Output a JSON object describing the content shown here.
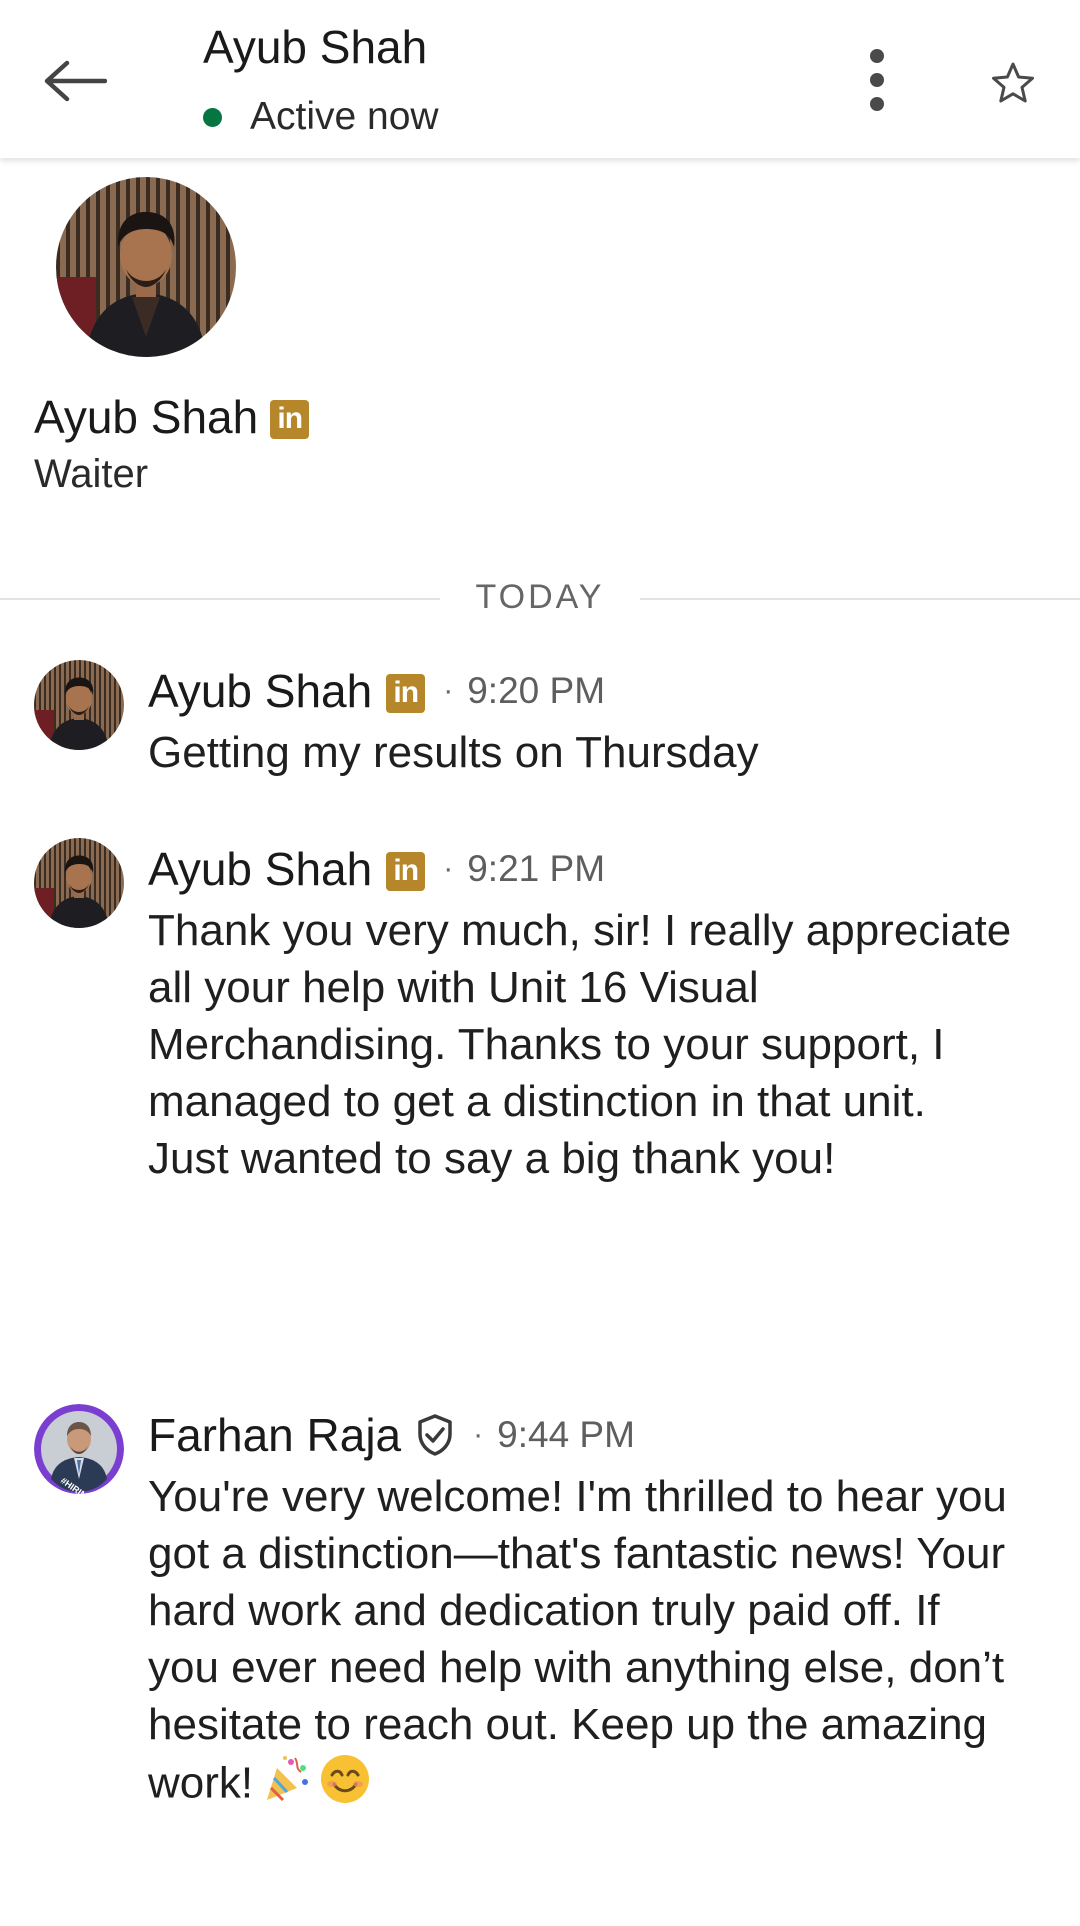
{
  "header": {
    "contact_name": "Ayub Shah",
    "status": "Active now",
    "status_color": "#057642"
  },
  "profile": {
    "name": "Ayub Shah",
    "badge_label": "in",
    "headline": "Waiter",
    "badge_color": "#b5872a"
  },
  "divider": {
    "label": "TODAY"
  },
  "messages": [
    {
      "sender": "Ayub Shah",
      "badge_label": "in",
      "separator": "·",
      "time": "9:20 PM",
      "text": "Getting my results on Thursday"
    },
    {
      "sender": "Ayub Shah",
      "badge_label": "in",
      "separator": "·",
      "time": "9:21 PM",
      "text": "Thank you very much, sir! I really appreciate all your help with Unit 16 Visual Merchandising. Thanks to your support, I managed to get a distinction in that unit. Just wanted to say a big thank you!"
    },
    {
      "sender": "Farhan Raja",
      "separator": "·",
      "time": "9:44 PM",
      "text": "You're very welcome! I'm thrilled to hear you got a distinction—that's fantastic news! Your hard work and dedication truly paid off. If you ever need help with anything else, don’t hesitate to reach out. Keep up the amazing work!",
      "avatar_ring_text": "#HIRING",
      "emojis": [
        "party-popper-emoji",
        "smiling-face-emoji"
      ]
    }
  ],
  "icons": {
    "back": "back-arrow-icon",
    "more": "more-vertical-icon",
    "star": "star-outline-icon",
    "verified": "verified-shield-icon"
  }
}
